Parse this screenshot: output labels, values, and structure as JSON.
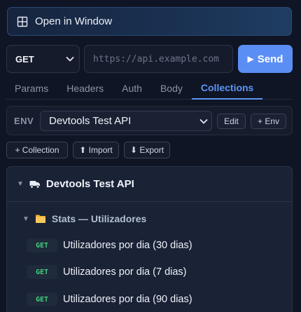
{
  "open_window": {
    "label": "Open in Window",
    "icon": "window-grid-icon"
  },
  "request": {
    "method": "GET",
    "url_placeholder": "https://api.example.com",
    "send_label": "Send"
  },
  "tabs": [
    {
      "label": "Params",
      "active": false
    },
    {
      "label": "Headers",
      "active": false
    },
    {
      "label": "Auth",
      "active": false
    },
    {
      "label": "Body",
      "active": false
    },
    {
      "label": "Collections",
      "active": true
    }
  ],
  "env": {
    "label": "ENV",
    "selected": "Devtools Test API",
    "edit_label": "Edit",
    "add_env_label": "+ Env"
  },
  "actions": {
    "add_collection": "+ Collection",
    "import": "⬆ Import",
    "export": "⬇ Export"
  },
  "collection": {
    "name": "Devtools Test API",
    "folder": {
      "name": "Stats — Utilizadores",
      "requests": [
        {
          "method": "GET",
          "name": "Utilizadores por dia (30 dias)"
        },
        {
          "method": "GET",
          "name": "Utilizadores por dia (7 dias)"
        },
        {
          "method": "GET",
          "name": "Utilizadores por dia (90 dias)"
        }
      ]
    }
  },
  "colors": {
    "accent": "#5b8ef5",
    "get_method": "#3fcf7e",
    "background": "#0f1524"
  }
}
